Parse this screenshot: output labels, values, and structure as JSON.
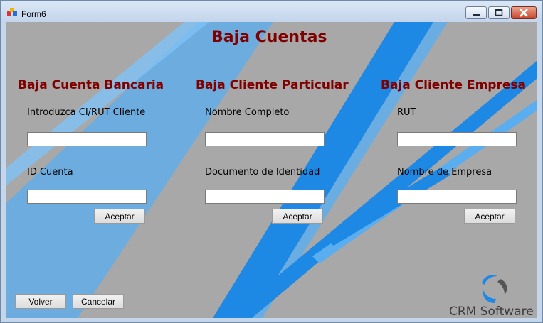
{
  "window": {
    "title": "Form6"
  },
  "page_title": "Baja Cuentas",
  "sections": [
    {
      "heading": "Baja Cuenta Bancaria",
      "field1_label": "Introduzca CI/RUT Cliente",
      "field1_value": "",
      "field2_label": "ID Cuenta",
      "field2_value": "",
      "button": "Aceptar"
    },
    {
      "heading": "Baja Cliente Particular",
      "field1_label": "Nombre Completo",
      "field1_value": "",
      "field2_label": "Documento de Identidad",
      "field2_value": "",
      "button": "Aceptar"
    },
    {
      "heading": "Baja Cliente Empresa",
      "field1_label": "RUT",
      "field1_value": "",
      "field2_label": "Nombre de Empresa",
      "field2_value": "",
      "button": "Aceptar"
    }
  ],
  "footer": {
    "back_button": "Volver",
    "cancel_button": "Cancelar"
  },
  "brand": {
    "name": "CRM Software"
  },
  "colors": {
    "heading": "#800000",
    "background": "#a8a8a8",
    "stripe_light": "#5aaef0",
    "stripe_dark": "#1e88e5"
  }
}
